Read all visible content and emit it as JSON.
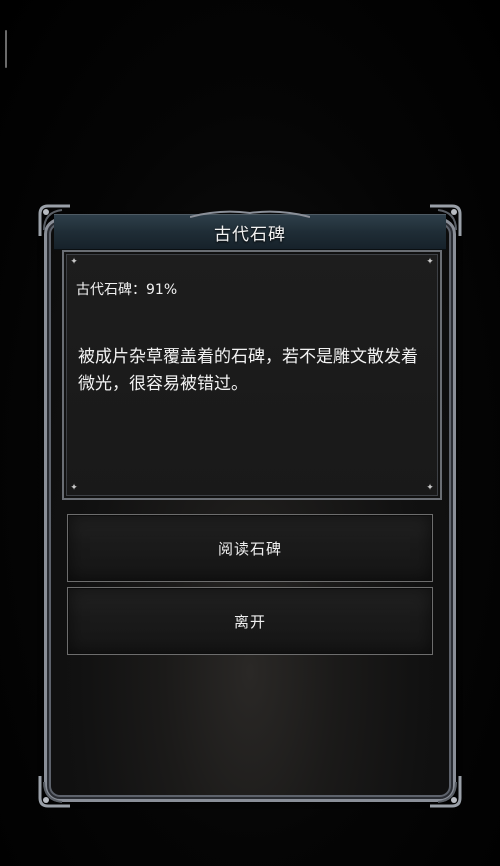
{
  "dialog": {
    "title": "古代石碑",
    "status_label": "古代石碑：91%",
    "description": "被成片杂草覆盖着的石碑，若不是雕文散发着微光，很容易被错过。",
    "actions": [
      {
        "label": "阅读石碑"
      },
      {
        "label": "离开"
      }
    ]
  },
  "colors": {
    "title_bar": "#1f2d36",
    "frame": "#8a8f98",
    "panel": "#1b1b1b",
    "text": "#f2f2f2"
  },
  "icons": [
    "sparkle-icon",
    "ornate-corner-icon"
  ]
}
